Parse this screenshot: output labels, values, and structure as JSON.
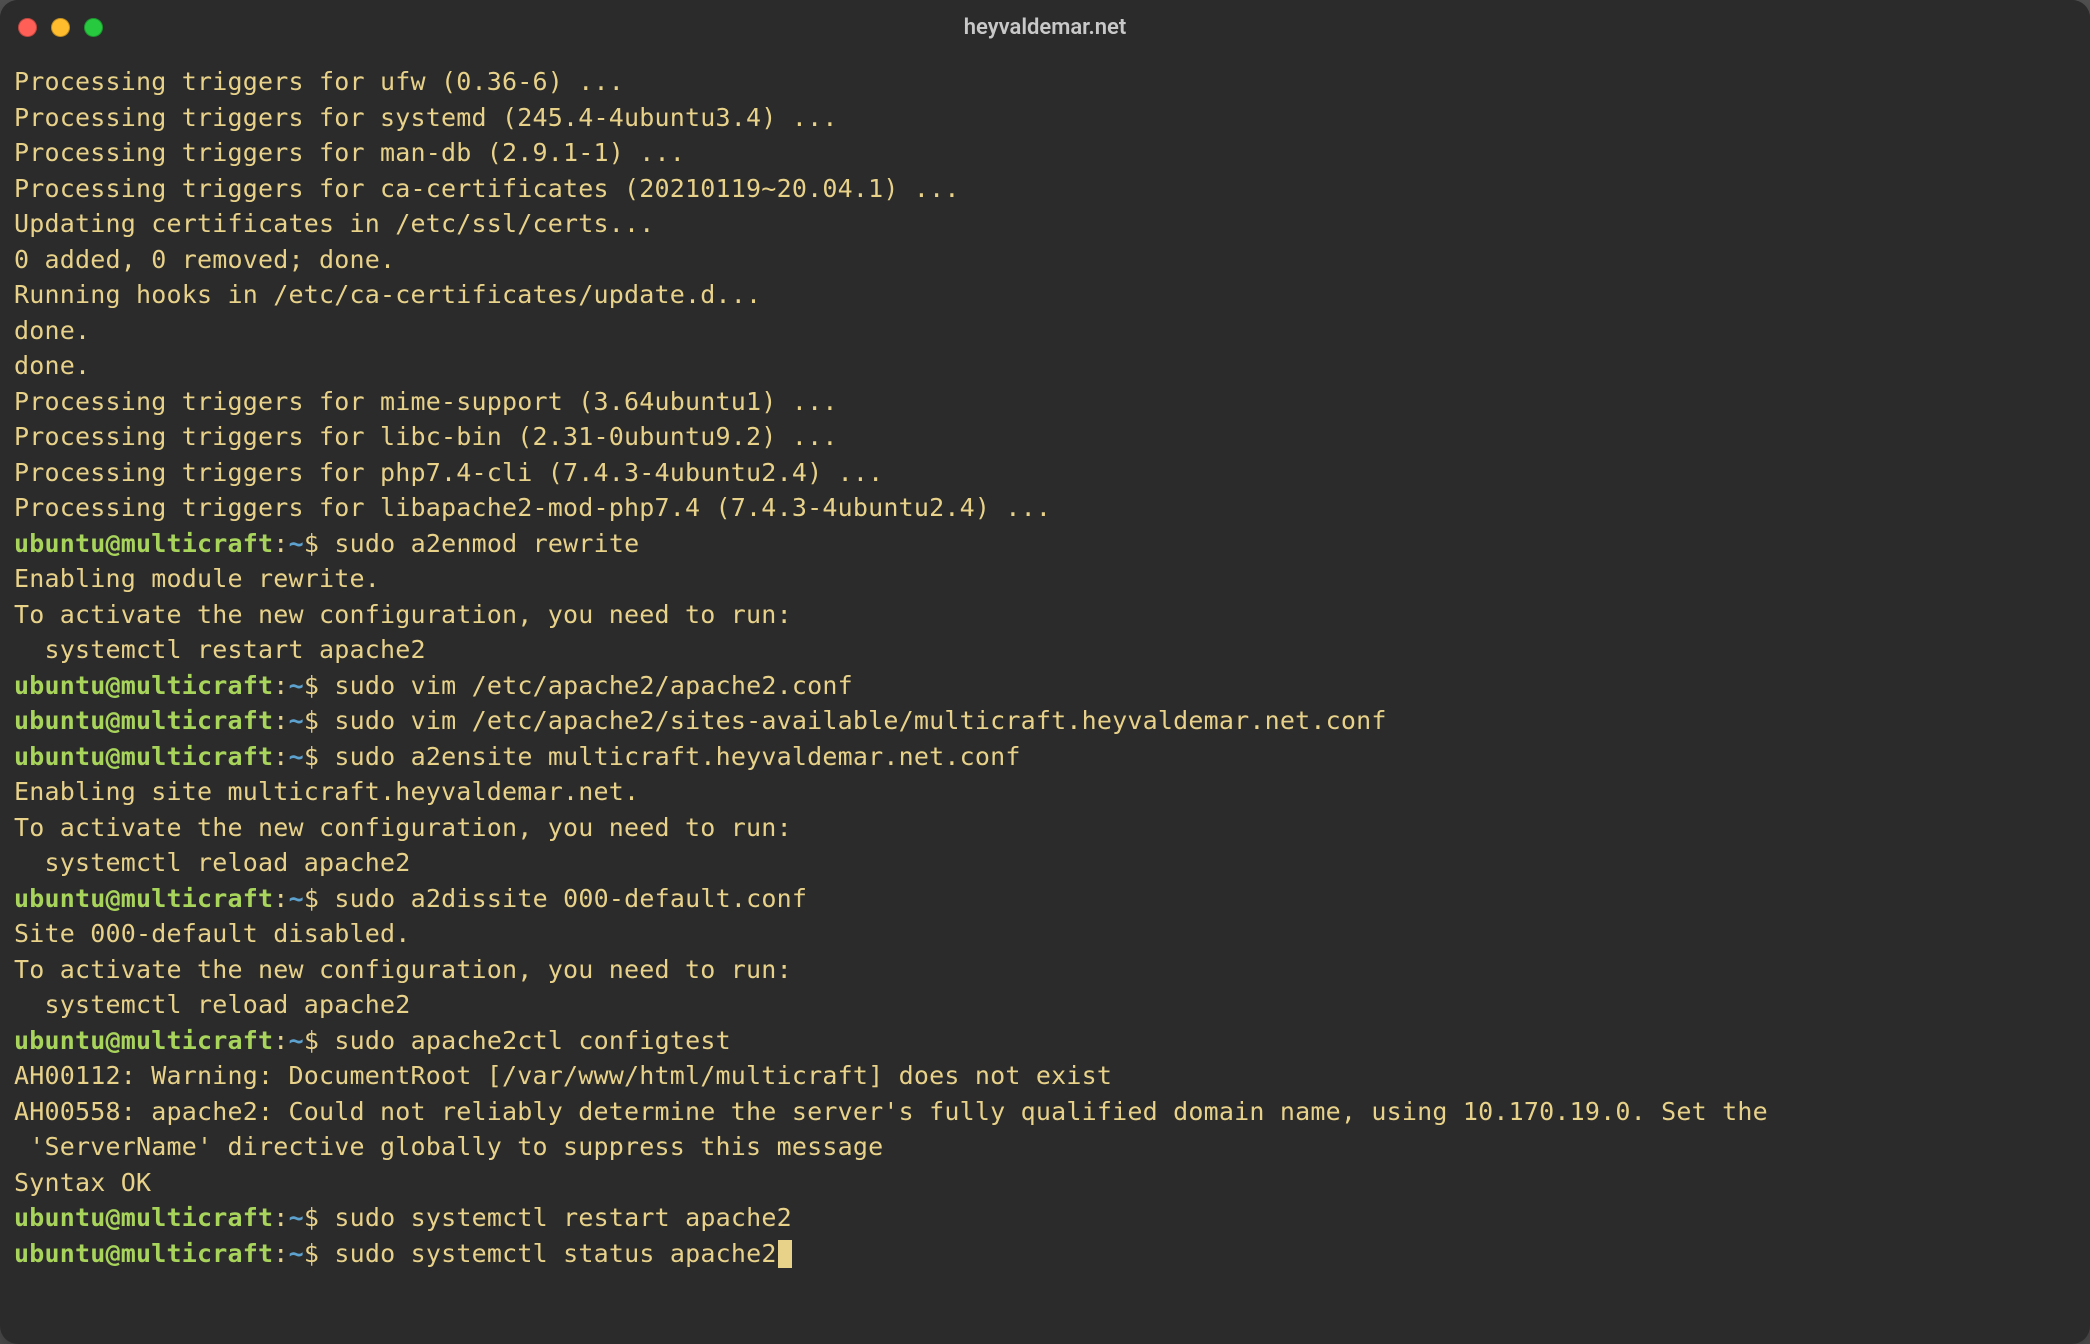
{
  "window": {
    "title": "heyvaldemar.net"
  },
  "prompt": {
    "user": "ubuntu",
    "at": "@",
    "host": "multicraft",
    "colon": ":",
    "path": "~",
    "dollar": "$ "
  },
  "lines": [
    {
      "t": "out",
      "text": "Processing triggers for ufw (0.36-6) ..."
    },
    {
      "t": "out",
      "text": "Processing triggers for systemd (245.4-4ubuntu3.4) ..."
    },
    {
      "t": "out",
      "text": "Processing triggers for man-db (2.9.1-1) ..."
    },
    {
      "t": "out",
      "text": "Processing triggers for ca-certificates (20210119~20.04.1) ..."
    },
    {
      "t": "out",
      "text": "Updating certificates in /etc/ssl/certs..."
    },
    {
      "t": "out",
      "text": "0 added, 0 removed; done."
    },
    {
      "t": "out",
      "text": "Running hooks in /etc/ca-certificates/update.d..."
    },
    {
      "t": "out",
      "text": ""
    },
    {
      "t": "out",
      "text": "done."
    },
    {
      "t": "out",
      "text": "done."
    },
    {
      "t": "out",
      "text": "Processing triggers for mime-support (3.64ubuntu1) ..."
    },
    {
      "t": "out",
      "text": "Processing triggers for libc-bin (2.31-0ubuntu9.2) ..."
    },
    {
      "t": "out",
      "text": "Processing triggers for php7.4-cli (7.4.3-4ubuntu2.4) ..."
    },
    {
      "t": "out",
      "text": "Processing triggers for libapache2-mod-php7.4 (7.4.3-4ubuntu2.4) ..."
    },
    {
      "t": "cmd",
      "text": "sudo a2enmod rewrite"
    },
    {
      "t": "out",
      "text": "Enabling module rewrite."
    },
    {
      "t": "out",
      "text": "To activate the new configuration, you need to run:"
    },
    {
      "t": "out",
      "text": "  systemctl restart apache2"
    },
    {
      "t": "cmd",
      "text": "sudo vim /etc/apache2/apache2.conf"
    },
    {
      "t": "cmd",
      "text": "sudo vim /etc/apache2/sites-available/multicraft.heyvaldemar.net.conf"
    },
    {
      "t": "cmd",
      "text": "sudo a2ensite multicraft.heyvaldemar.net.conf"
    },
    {
      "t": "out",
      "text": "Enabling site multicraft.heyvaldemar.net."
    },
    {
      "t": "out",
      "text": "To activate the new configuration, you need to run:"
    },
    {
      "t": "out",
      "text": "  systemctl reload apache2"
    },
    {
      "t": "cmd",
      "text": "sudo a2dissite 000-default.conf"
    },
    {
      "t": "out",
      "text": "Site 000-default disabled."
    },
    {
      "t": "out",
      "text": "To activate the new configuration, you need to run:"
    },
    {
      "t": "out",
      "text": "  systemctl reload apache2"
    },
    {
      "t": "cmd",
      "text": "sudo apache2ctl configtest"
    },
    {
      "t": "out",
      "text": "AH00112: Warning: DocumentRoot [/var/www/html/multicraft] does not exist"
    },
    {
      "t": "out",
      "text": "AH00558: apache2: Could not reliably determine the server's fully qualified domain name, using 10.170.19.0. Set the\n 'ServerName' directive globally to suppress this message"
    },
    {
      "t": "out",
      "text": "Syntax OK"
    },
    {
      "t": "cmd",
      "text": "sudo systemctl restart apache2"
    },
    {
      "t": "cmd",
      "text": "sudo systemctl status apache2",
      "cursor": true
    }
  ]
}
